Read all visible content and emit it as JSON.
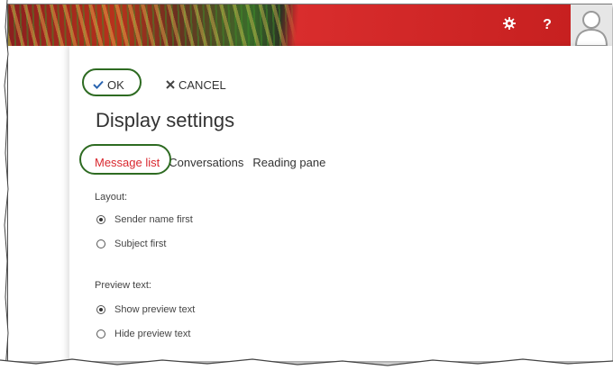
{
  "header": {
    "settings_icon": "gear-icon",
    "help_label": "?",
    "avatar_icon": "person-icon",
    "accent_color": "#c41e1e"
  },
  "toolbar": {
    "ok_label": "OK",
    "cancel_label": "CANCEL"
  },
  "page": {
    "title": "Display settings"
  },
  "tabs": [
    {
      "label": "Message list",
      "active": true
    },
    {
      "label": "Conversations",
      "active": false
    },
    {
      "label": "Reading pane",
      "active": false
    }
  ],
  "layout": {
    "label": "Layout:",
    "options": [
      {
        "label": "Sender name first",
        "selected": true
      },
      {
        "label": "Subject first",
        "selected": false
      }
    ]
  },
  "preview": {
    "label": "Preview text:",
    "options": [
      {
        "label": "Show preview text",
        "selected": true
      },
      {
        "label": "Hide preview text",
        "selected": false
      }
    ]
  },
  "annotation_color": "#2e6b22",
  "active_tab_color": "#d9282f"
}
